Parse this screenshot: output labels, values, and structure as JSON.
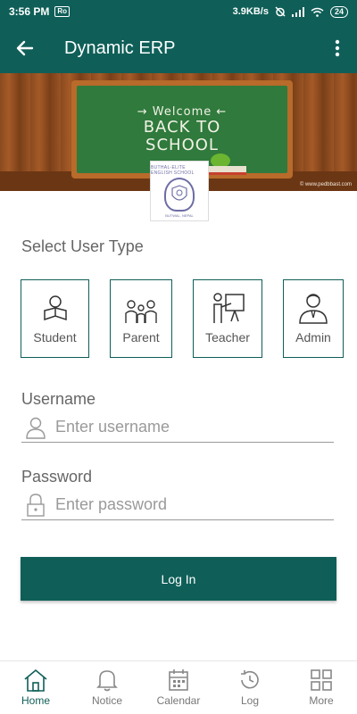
{
  "status_bar": {
    "time": "3:56 PM",
    "chip": "Ro",
    "speed": "3.9KB/s",
    "battery": "24"
  },
  "app_bar": {
    "title": "Dynamic ERP",
    "back_icon": "arrow-left-icon",
    "menu_icon": "more-vertical-icon"
  },
  "banner": {
    "welcome": "→ Welcome ←",
    "headline_line1": "BACK TO",
    "headline_line2": "SCHOOL",
    "watermark": "© www.pedbbast.com"
  },
  "logo": {
    "text_top": "BUTHAL-ELITE ENGLISH SCHOOL",
    "text_bottom": "BUTWAL, NEPAL"
  },
  "user_type": {
    "title": "Select User Type",
    "options": [
      {
        "label": "Student",
        "icon": "student-reading-icon"
      },
      {
        "label": "Parent",
        "icon": "family-icon"
      },
      {
        "label": "Teacher",
        "icon": "teacher-board-icon"
      },
      {
        "label": "Admin",
        "icon": "admin-person-icon"
      }
    ]
  },
  "form": {
    "username_label": "Username",
    "username_placeholder": "Enter username",
    "username_value": "",
    "password_label": "Password",
    "password_placeholder": "Enter password",
    "password_value": "",
    "login_label": "Log In"
  },
  "bottom_nav": {
    "items": [
      {
        "label": "Home",
        "icon": "home-icon",
        "active": true
      },
      {
        "label": "Notice",
        "icon": "bell-icon",
        "active": false
      },
      {
        "label": "Calendar",
        "icon": "calendar-icon",
        "active": false
      },
      {
        "label": "Log",
        "icon": "history-icon",
        "active": false
      },
      {
        "label": "More",
        "icon": "grid-icon",
        "active": false
      }
    ]
  },
  "colors": {
    "primary": "#0f5f58",
    "text": "#555555",
    "muted": "#9a9a9a"
  }
}
